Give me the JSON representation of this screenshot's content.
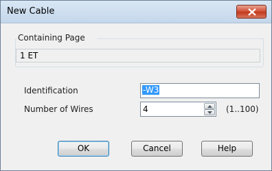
{
  "window": {
    "title": "New Cable"
  },
  "containing_page": {
    "group_label": "Containing Page",
    "value": "1 ET"
  },
  "identification": {
    "label": "Identification",
    "value": "-W3"
  },
  "number_of_wires": {
    "label": "Number of Wires",
    "value": "4",
    "range": "(1..100)"
  },
  "buttons": {
    "ok": "OK",
    "cancel": "Cancel",
    "help": "Help"
  },
  "colors": {
    "selection": "#3399ff",
    "close_button": "#c23b1f"
  }
}
